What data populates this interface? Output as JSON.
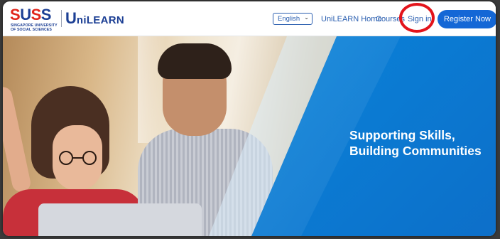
{
  "header": {
    "suss_logo_text": "SUSS",
    "suss_subtitle": "SINGAPORE UNIVERSITY OF SOCIAL SCIENCES",
    "unilearn_logo_big": "U",
    "unilearn_logo_small": "niLEARN",
    "language_select": {
      "value": "English"
    },
    "nav": {
      "home_label": "UniLEARN Home",
      "courses_label": "Courses",
      "signin_label": "Sign in"
    },
    "register_label": "Register Now"
  },
  "hero": {
    "heading_line1": "Supporting Skills,",
    "heading_line2": "Building Communities"
  },
  "colors": {
    "brand_navy": "#1c3f94",
    "brand_red": "#e1251b",
    "link_blue": "#2b5fb0",
    "button_blue": "#1467d6",
    "hero_blue": "#0a7fd6",
    "annotation_red": "#e3141b"
  },
  "icons": {
    "language_dropdown": "chevron-down-icon"
  }
}
